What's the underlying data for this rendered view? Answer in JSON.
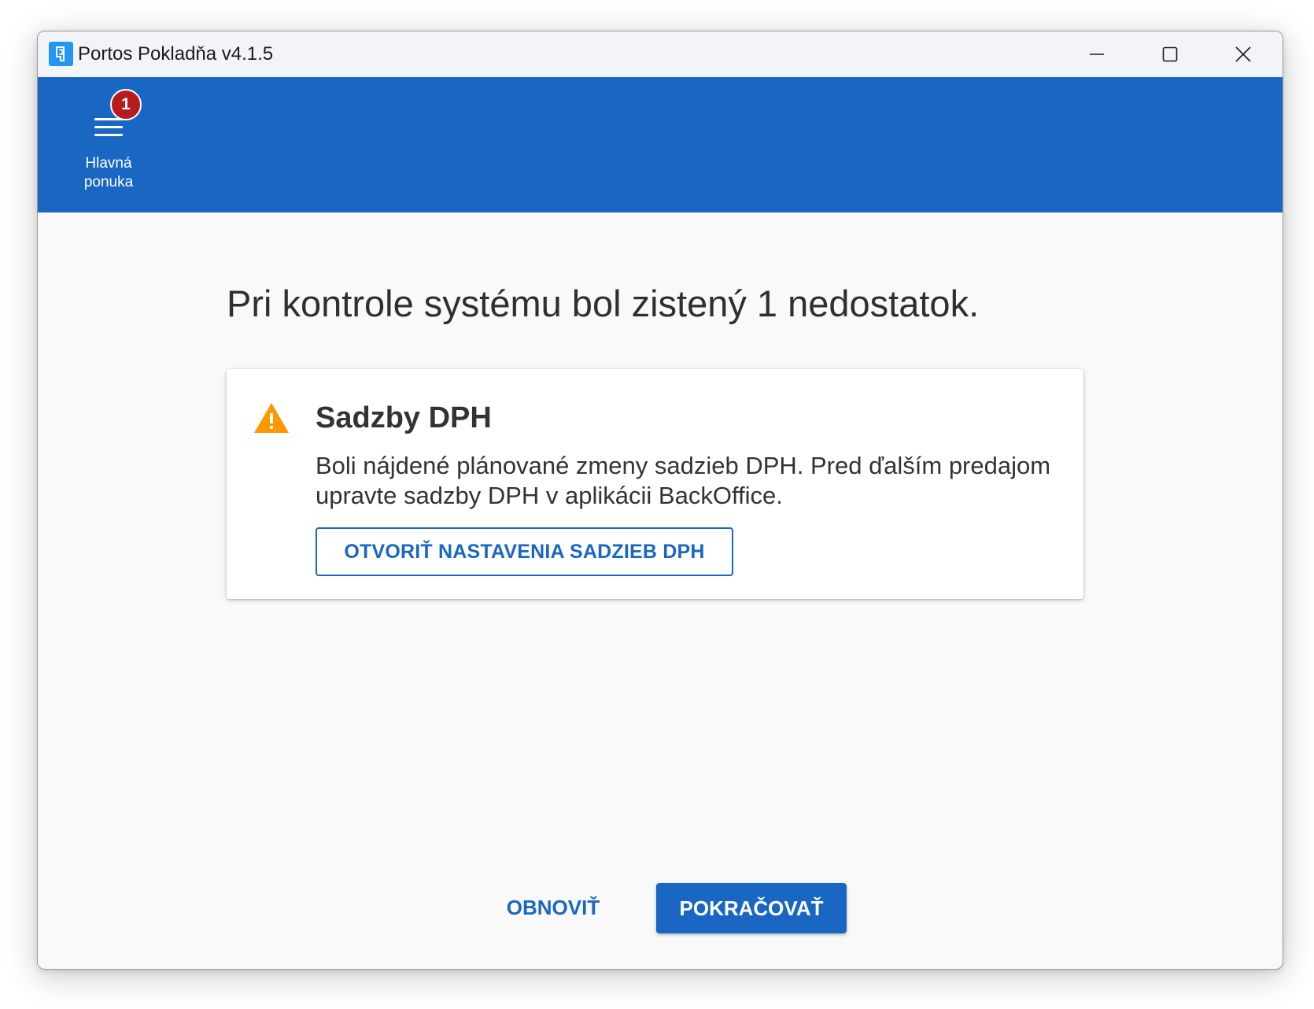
{
  "window": {
    "title": "Portos Pokladňa v4.1.5"
  },
  "appbar": {
    "menu_label": "Hlavná\nponuka",
    "menu_badge": "1"
  },
  "main": {
    "headline": "Pri kontrole systému bol zistený 1 nedostatok.",
    "issue": {
      "icon": "warning-icon",
      "title": "Sadzby DPH",
      "text": "Boli nájdené plánované zmeny sadzieb DPH. Pred ďalším predajom upravte sadzby DPH v aplikácii BackOffice.",
      "action_label": "OTVORIŤ NASTAVENIA SADZIEB DPH"
    }
  },
  "footer": {
    "refresh_label": "OBNOVIŤ",
    "continue_label": "POKRAČOVAŤ"
  },
  "colors": {
    "primary": "#1967c2",
    "warning": "#ff9800",
    "badge": "#b71c1c"
  }
}
